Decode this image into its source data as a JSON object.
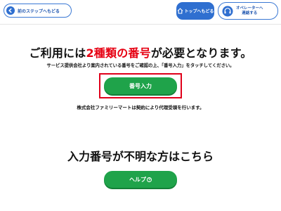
{
  "header": {
    "back_label": "前のステップへもどる",
    "top_label": "トップへもどる",
    "operator_label_line1": "オペレーターへ",
    "operator_label_line2": "連絡する"
  },
  "main": {
    "title_part1": "ご利用には",
    "title_highlight": "2種類の番号",
    "title_part2": "が必要となります。",
    "instruction": "サービス提供会社より案内されている番号をご確認の上、「番号入力」をタッチしてください。",
    "input_button_label": "番号入力",
    "agency_note": "株式会社ファミリーマートは契約により代理受領を行います。",
    "help_heading": "入力番号が不明な方はこちら",
    "help_button_label": "ヘルプ"
  },
  "colors": {
    "accent_blue": "#2f6fd0",
    "action_green": "#1fa34a",
    "highlight_red": "#e60012"
  },
  "icons": {
    "back": "back-arrow-icon",
    "top": "home-icon",
    "operator": "headset-icon",
    "help": "question-icon"
  }
}
